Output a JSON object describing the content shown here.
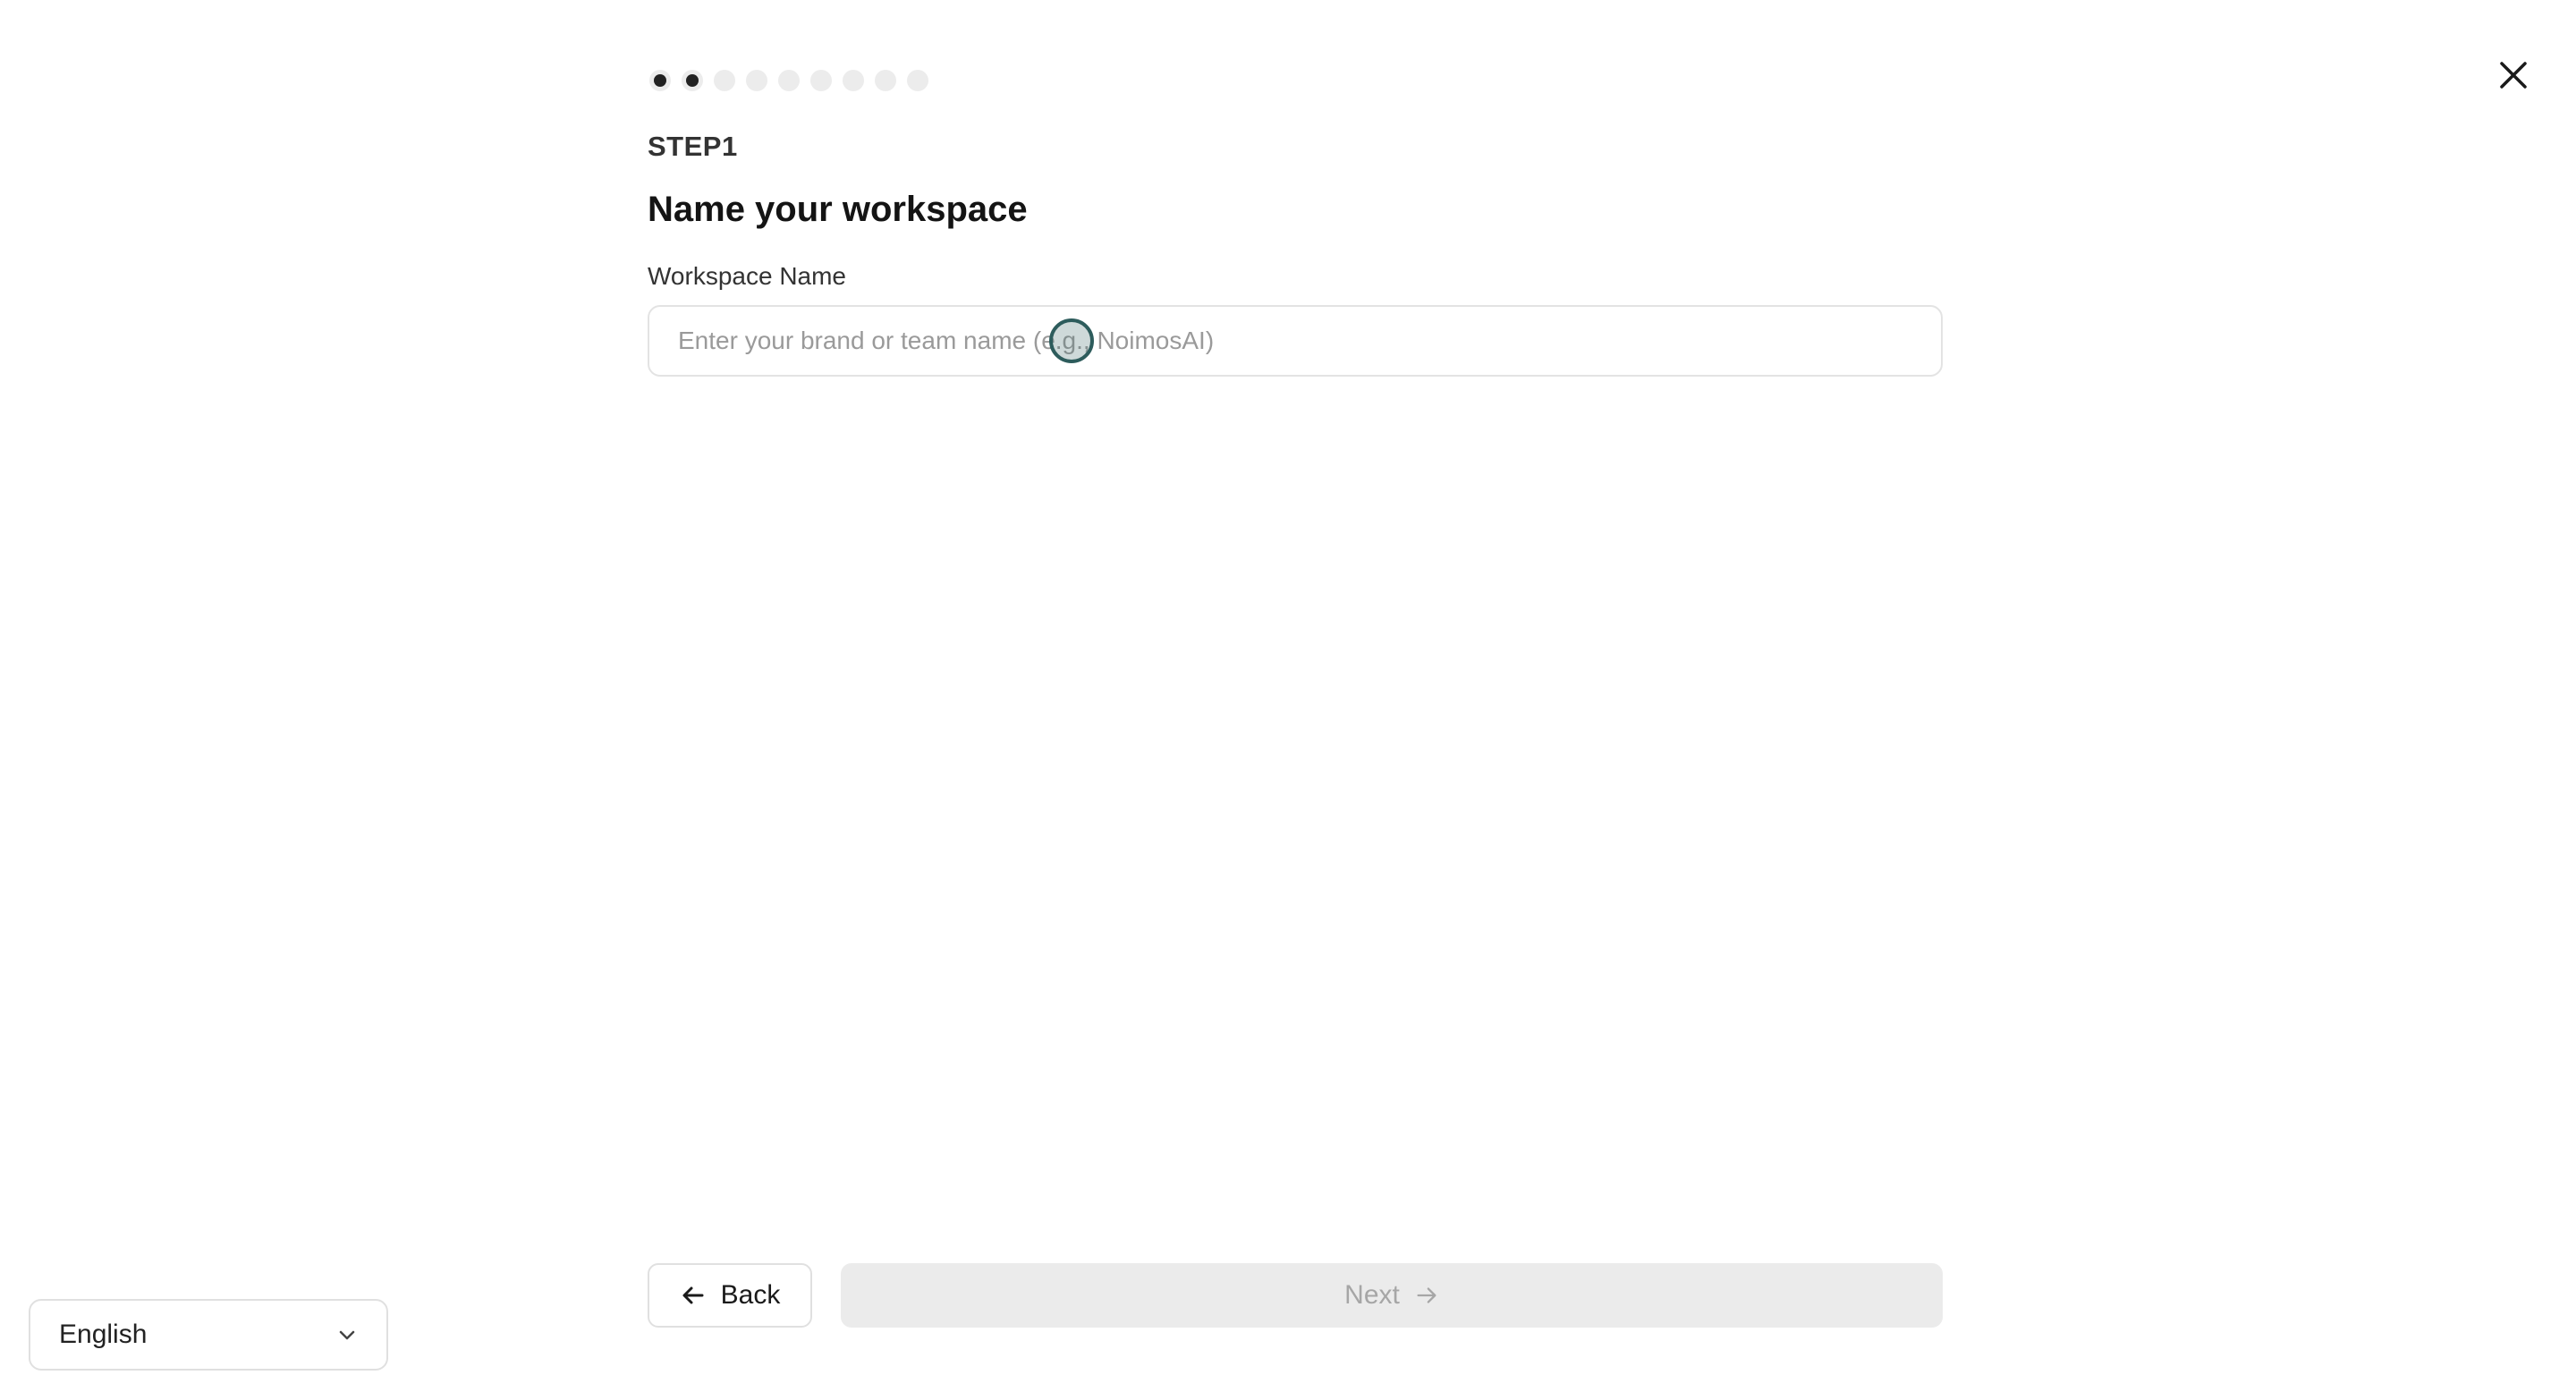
{
  "wizard": {
    "progress": {
      "total_steps": 9,
      "completed_steps": 2
    },
    "step_label": "STEP1",
    "title": "Name your workspace",
    "workspace_field": {
      "label": "Workspace Name",
      "value": "",
      "placeholder": "Enter your brand or team name (e.g., NoimosAI)"
    },
    "back_label": "Back",
    "next_label": "Next",
    "next_enabled": false
  },
  "language_select": {
    "selected": "English"
  },
  "icons": {
    "close": "close-icon",
    "back": "arrow-left-icon",
    "next": "arrow-right-icon",
    "dropdown": "chevron-down-icon"
  },
  "colors": {
    "dot_done": "#222222",
    "dot_pending": "#ececec",
    "next_disabled_bg": "#ebebeb",
    "next_disabled_text": "#a6a6a6",
    "cursor_ring": "#2d5c5c"
  }
}
